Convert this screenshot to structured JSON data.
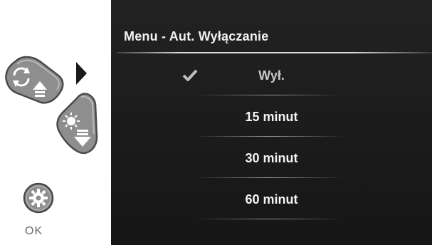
{
  "controls": {
    "ok_label": "OK"
  },
  "menu": {
    "title": "Menu - Aut. Wyłączanie",
    "options": [
      {
        "label": "Wył.",
        "selected": true
      },
      {
        "label": "15 minut",
        "selected": false
      },
      {
        "label": "30 minut",
        "selected": false
      },
      {
        "label": "60 minut",
        "selected": false
      }
    ]
  },
  "icons": [
    "rotate-up-button-icon",
    "brightness-down-button-icon",
    "settings-ok-button-icon",
    "play-arrow-icon",
    "checkmark-icon"
  ],
  "colors": {
    "screen_bg": "#1b1b1b",
    "text": "#f4f4f4",
    "button": "#9a9a9a"
  }
}
